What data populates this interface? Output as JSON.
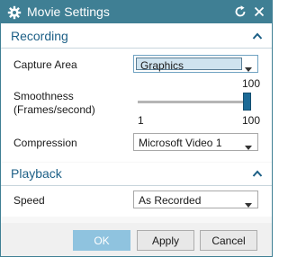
{
  "window": {
    "title": "Movie Settings",
    "icons": {
      "app": "gear-icon",
      "reset": "refresh-icon",
      "close": "close-icon"
    },
    "colors": {
      "titlebar": "#3f7f94",
      "section_title": "#1c5f86",
      "slider_thumb": "#1c6a96",
      "ok_disabled": "#8fc3df"
    }
  },
  "recording": {
    "title": "Recording",
    "collapse_icon": "chevron-up-icon",
    "capture_area": {
      "label": "Capture Area",
      "value": "Graphics"
    },
    "smoothness": {
      "label_line1": "Smoothness",
      "label_line2": "(Frames/second)",
      "value": 100,
      "value_text": "100",
      "min_text": "1",
      "max_text": "100",
      "min": 1,
      "max": 100
    },
    "compression": {
      "label": "Compression",
      "value": "Microsoft Video 1"
    }
  },
  "playback": {
    "title": "Playback",
    "collapse_icon": "chevron-up-icon",
    "speed": {
      "label": "Speed",
      "value": "As Recorded"
    }
  },
  "buttons": {
    "ok": "OK",
    "apply": "Apply",
    "cancel": "Cancel"
  }
}
